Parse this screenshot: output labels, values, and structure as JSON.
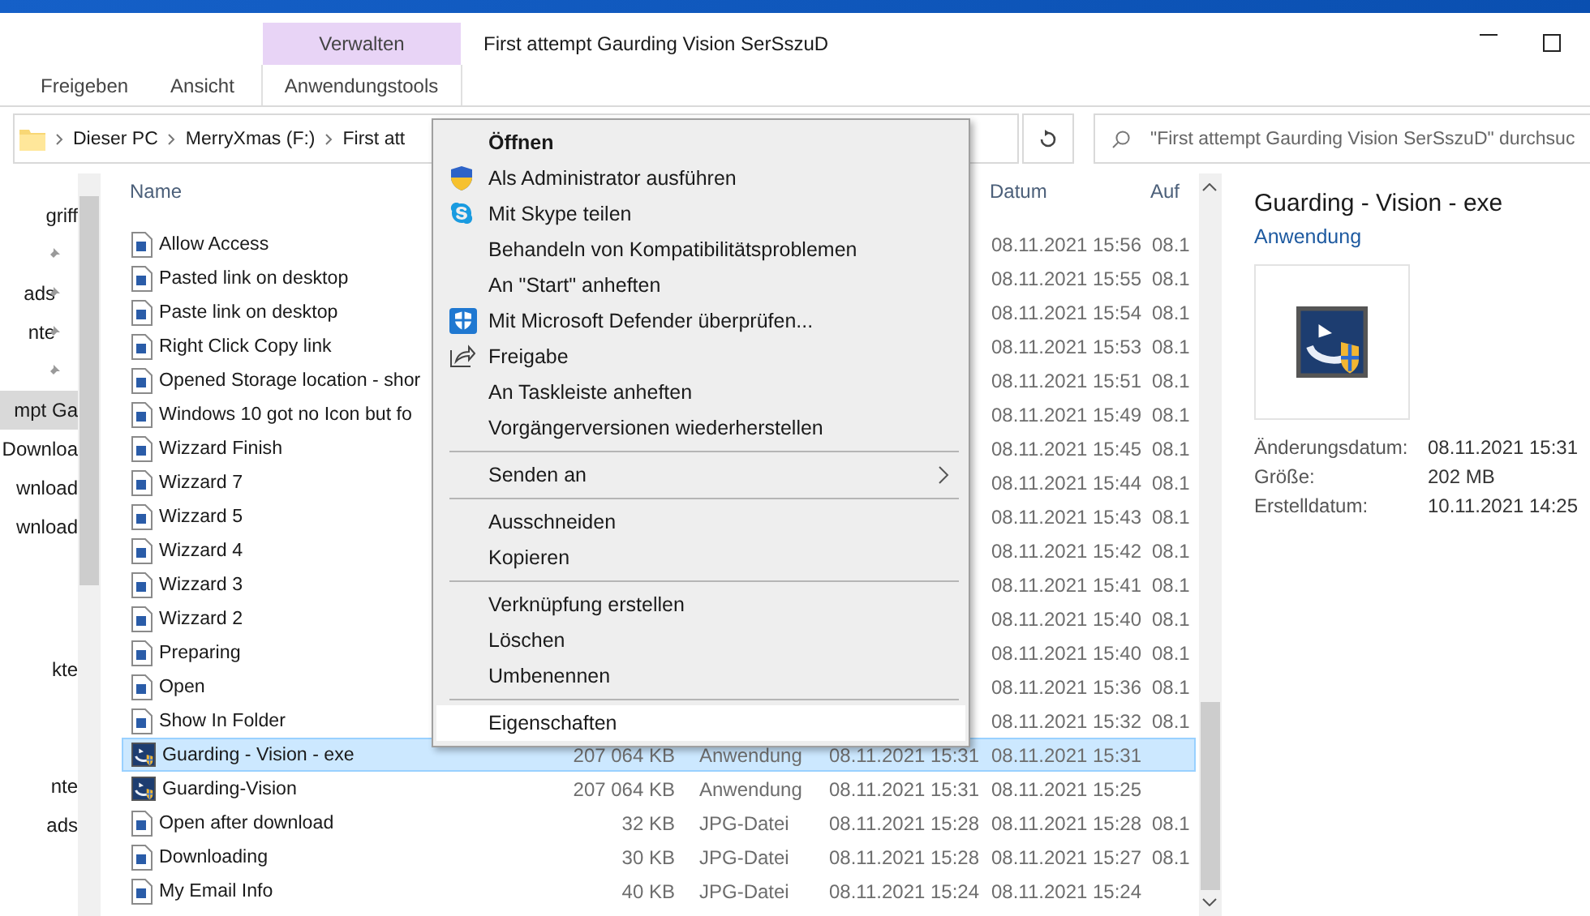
{
  "window": {
    "title": "First attempt Gaurding Vision SerSszuD",
    "context_tab": "Verwalten"
  },
  "ribbon_tabs": [
    {
      "label": "Freigeben",
      "selected": false
    },
    {
      "label": "Ansicht",
      "selected": false
    },
    {
      "label": "Anwendungstools",
      "selected": true
    }
  ],
  "address_bar": {
    "path": [
      "Dieser PC",
      "MerryXmas (F:)",
      "First att"
    ]
  },
  "search": {
    "placeholder": "\"First attempt Gaurding Vision SerSszuD\" durchsuc"
  },
  "navigation": {
    "groups": [
      [
        {
          "label": "griff",
          "pinned": false,
          "selected": false
        },
        {
          "pinned": true,
          "selected": false
        },
        {
          "label": "ads",
          "pinned": true,
          "selected": false
        },
        {
          "label": "nte",
          "pinned": true,
          "selected": false
        },
        {
          "pinned": true,
          "selected": false
        },
        {
          "label": "mpt Ga",
          "pinned": false,
          "selected": true
        },
        {
          "label": "Downloa",
          "pinned": false,
          "selected": false
        },
        {
          "label": "wnload",
          "pinned": false,
          "selected": false
        },
        {
          "label": "wnload",
          "pinned": false,
          "selected": false
        }
      ],
      [
        {
          "label": "kte",
          "pinned": false,
          "selected": false
        }
      ],
      [
        {
          "label": "nte",
          "pinned": false,
          "selected": false
        },
        {
          "label": "ads",
          "pinned": false,
          "selected": false
        }
      ]
    ]
  },
  "file_list": {
    "columns": {
      "name": "Name",
      "date": "Datum",
      "column_6": "Auf"
    },
    "rows": [
      {
        "name": "Allow Access",
        "kind": "image",
        "date": "08.11.2021 15:56",
        "column_6": "08.1",
        "selected": false
      },
      {
        "name": "Pasted link on desktop",
        "kind": "image",
        "date": "08.11.2021 15:55",
        "column_6": "08.1",
        "selected": false
      },
      {
        "name": "Paste link on desktop",
        "kind": "image",
        "date": "08.11.2021 15:54",
        "column_6": "08.1",
        "selected": false
      },
      {
        "name": "Right Click Copy link",
        "kind": "image",
        "date": "08.11.2021 15:53",
        "column_6": "08.1",
        "selected": false
      },
      {
        "name": "Opened Storage location - shor",
        "kind": "image",
        "date": "08.11.2021 15:51",
        "column_6": "08.1",
        "selected": false
      },
      {
        "name": "Windows 10 got no Icon but fo",
        "kind": "image",
        "date": "08.11.2021 15:49",
        "column_6": "08.1",
        "selected": false
      },
      {
        "name": "Wizzard Finish",
        "kind": "image",
        "date": "08.11.2021 15:45",
        "column_6": "08.1",
        "selected": false
      },
      {
        "name": "Wizzard 7",
        "kind": "image",
        "date": "08.11.2021 15:44",
        "column_6": "08.1",
        "selected": false
      },
      {
        "name": "Wizzard 5",
        "kind": "image",
        "date": "08.11.2021 15:43",
        "column_6": "08.1",
        "selected": false
      },
      {
        "name": "Wizzard 4",
        "kind": "image",
        "date": "08.11.2021 15:42",
        "column_6": "08.1",
        "selected": false
      },
      {
        "name": "Wizzard 3",
        "kind": "image",
        "date": "08.11.2021 15:41",
        "column_6": "08.1",
        "selected": false
      },
      {
        "name": "Wizzard 2",
        "kind": "image",
        "date": "08.11.2021 15:40",
        "column_6": "08.1",
        "selected": false
      },
      {
        "name": "Preparing",
        "kind": "image",
        "date": "08.11.2021 15:40",
        "column_6": "08.1",
        "selected": false
      },
      {
        "name": "Open",
        "kind": "image",
        "date": "08.11.2021 15:36",
        "column_6": "08.1",
        "selected": false
      },
      {
        "name": "Show In Folder",
        "kind": "image",
        "date": "08.11.2021 15:32",
        "column_6": "08.1",
        "selected": false
      },
      {
        "name": "Guarding - Vision - exe",
        "kind": "app",
        "size": "207 064 KB",
        "type": "Anwendung",
        "created": "08.11.2021 15:31",
        "date": "08.11.2021 15:31",
        "selected": true
      },
      {
        "name": "Guarding-Vision",
        "kind": "app",
        "size": "207 064 KB",
        "type": "Anwendung",
        "created": "08.11.2021 15:31",
        "date": "08.11.2021 15:25",
        "selected": false
      },
      {
        "name": "Open after download",
        "kind": "image",
        "size": "32 KB",
        "type": "JPG-Datei",
        "created": "08.11.2021 15:28",
        "date": "08.11.2021 15:28",
        "column_6": "08.1",
        "selected": false
      },
      {
        "name": "Downloading",
        "kind": "image",
        "size": "30 KB",
        "type": "JPG-Datei",
        "created": "08.11.2021 15:28",
        "date": "08.11.2021 15:27",
        "column_6": "08.1",
        "selected": false
      },
      {
        "name": "My Email Info",
        "kind": "image",
        "size": "40 KB",
        "type": "JPG-Datei",
        "created": "08.11.2021 15:24",
        "date": "08.11.2021 15:24",
        "selected": false
      }
    ]
  },
  "preview": {
    "title": "Guarding - Vision - exe",
    "subtitle": "Anwendung",
    "properties": [
      {
        "label": "Änderungsdatum:",
        "value": "08.11.2021 15:31"
      },
      {
        "label": "Größe:",
        "value": "202 MB"
      },
      {
        "label": "Erstelldatum:",
        "value": "10.11.2021 14:25"
      }
    ]
  },
  "context_menu": {
    "groups": [
      [
        {
          "label": "Öffnen",
          "default": true,
          "submenu": false,
          "selected": false
        },
        {
          "label": "Als Administrator ausführen",
          "default": false,
          "submenu": false,
          "selected": false
        },
        {
          "label": "Mit Skype teilen",
          "default": false,
          "submenu": false,
          "selected": false
        },
        {
          "label": "Behandeln von Kompatibilitätsproblemen",
          "default": false,
          "submenu": false,
          "selected": false
        },
        {
          "label": "An \"Start\" anheften",
          "default": false,
          "submenu": false,
          "selected": false
        },
        {
          "label": "Mit Microsoft Defender überprüfen...",
          "default": false,
          "submenu": false,
          "selected": false
        },
        {
          "label": "Freigabe",
          "default": false,
          "submenu": false,
          "selected": false
        },
        {
          "label": "An Taskleiste anheften",
          "default": false,
          "submenu": false,
          "selected": false
        },
        {
          "label": "Vorgängerversionen wiederherstellen",
          "default": false,
          "submenu": false,
          "selected": false
        }
      ],
      [
        {
          "label": "Senden an",
          "default": false,
          "submenu": true,
          "selected": false
        }
      ],
      [
        {
          "label": "Ausschneiden",
          "default": false,
          "submenu": false,
          "selected": false
        },
        {
          "label": "Kopieren",
          "default": false,
          "submenu": false,
          "selected": false
        }
      ],
      [
        {
          "label": "Verknüpfung erstellen",
          "default": false,
          "submenu": false,
          "selected": false
        },
        {
          "label": "Löschen",
          "default": false,
          "submenu": false,
          "selected": false
        },
        {
          "label": "Umbenennen",
          "default": false,
          "submenu": false,
          "selected": false
        }
      ],
      [
        {
          "label": "Eigenschaften",
          "default": false,
          "submenu": false,
          "selected": true
        }
      ]
    ]
  }
}
